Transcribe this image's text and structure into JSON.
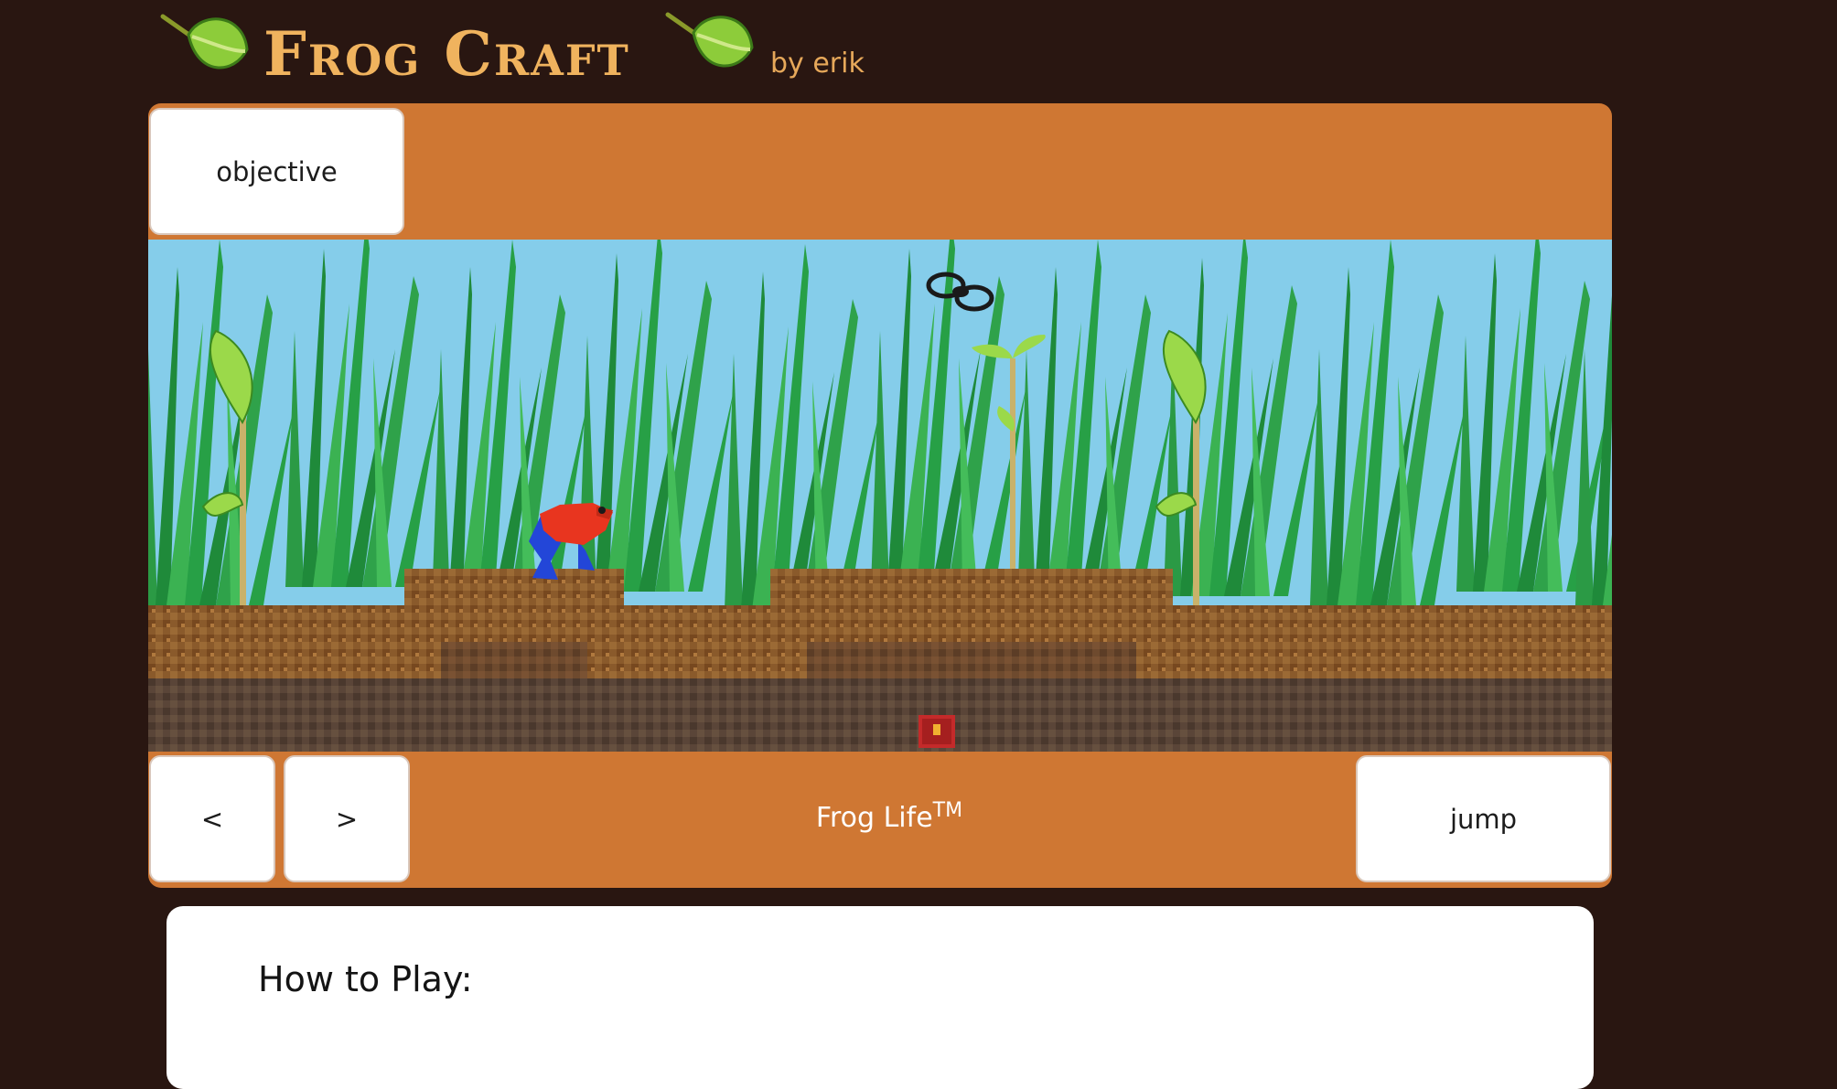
{
  "header": {
    "title": "Frog Craft",
    "byline": "by erik",
    "decor_icon": "leaf-icon"
  },
  "game": {
    "objective_label": "objective",
    "move_left_label": "<",
    "move_right_label": ">",
    "jump_label": "jump",
    "status_text": "Frog Life",
    "status_superscript": "TM",
    "sprites": [
      "frog",
      "fly",
      "grass",
      "sapling",
      "dirt-blocks",
      "treasure-chest"
    ]
  },
  "instructions": {
    "heading": "How to Play:"
  },
  "colors": {
    "background": "#291611",
    "frame": "#cf7733",
    "sky": "#85cdea",
    "title": "#f0b35e",
    "grass": "#2fa24a",
    "dirt": "#8b5a2b",
    "frog_body": "#e8351f",
    "frog_legs": "#2346d8"
  }
}
